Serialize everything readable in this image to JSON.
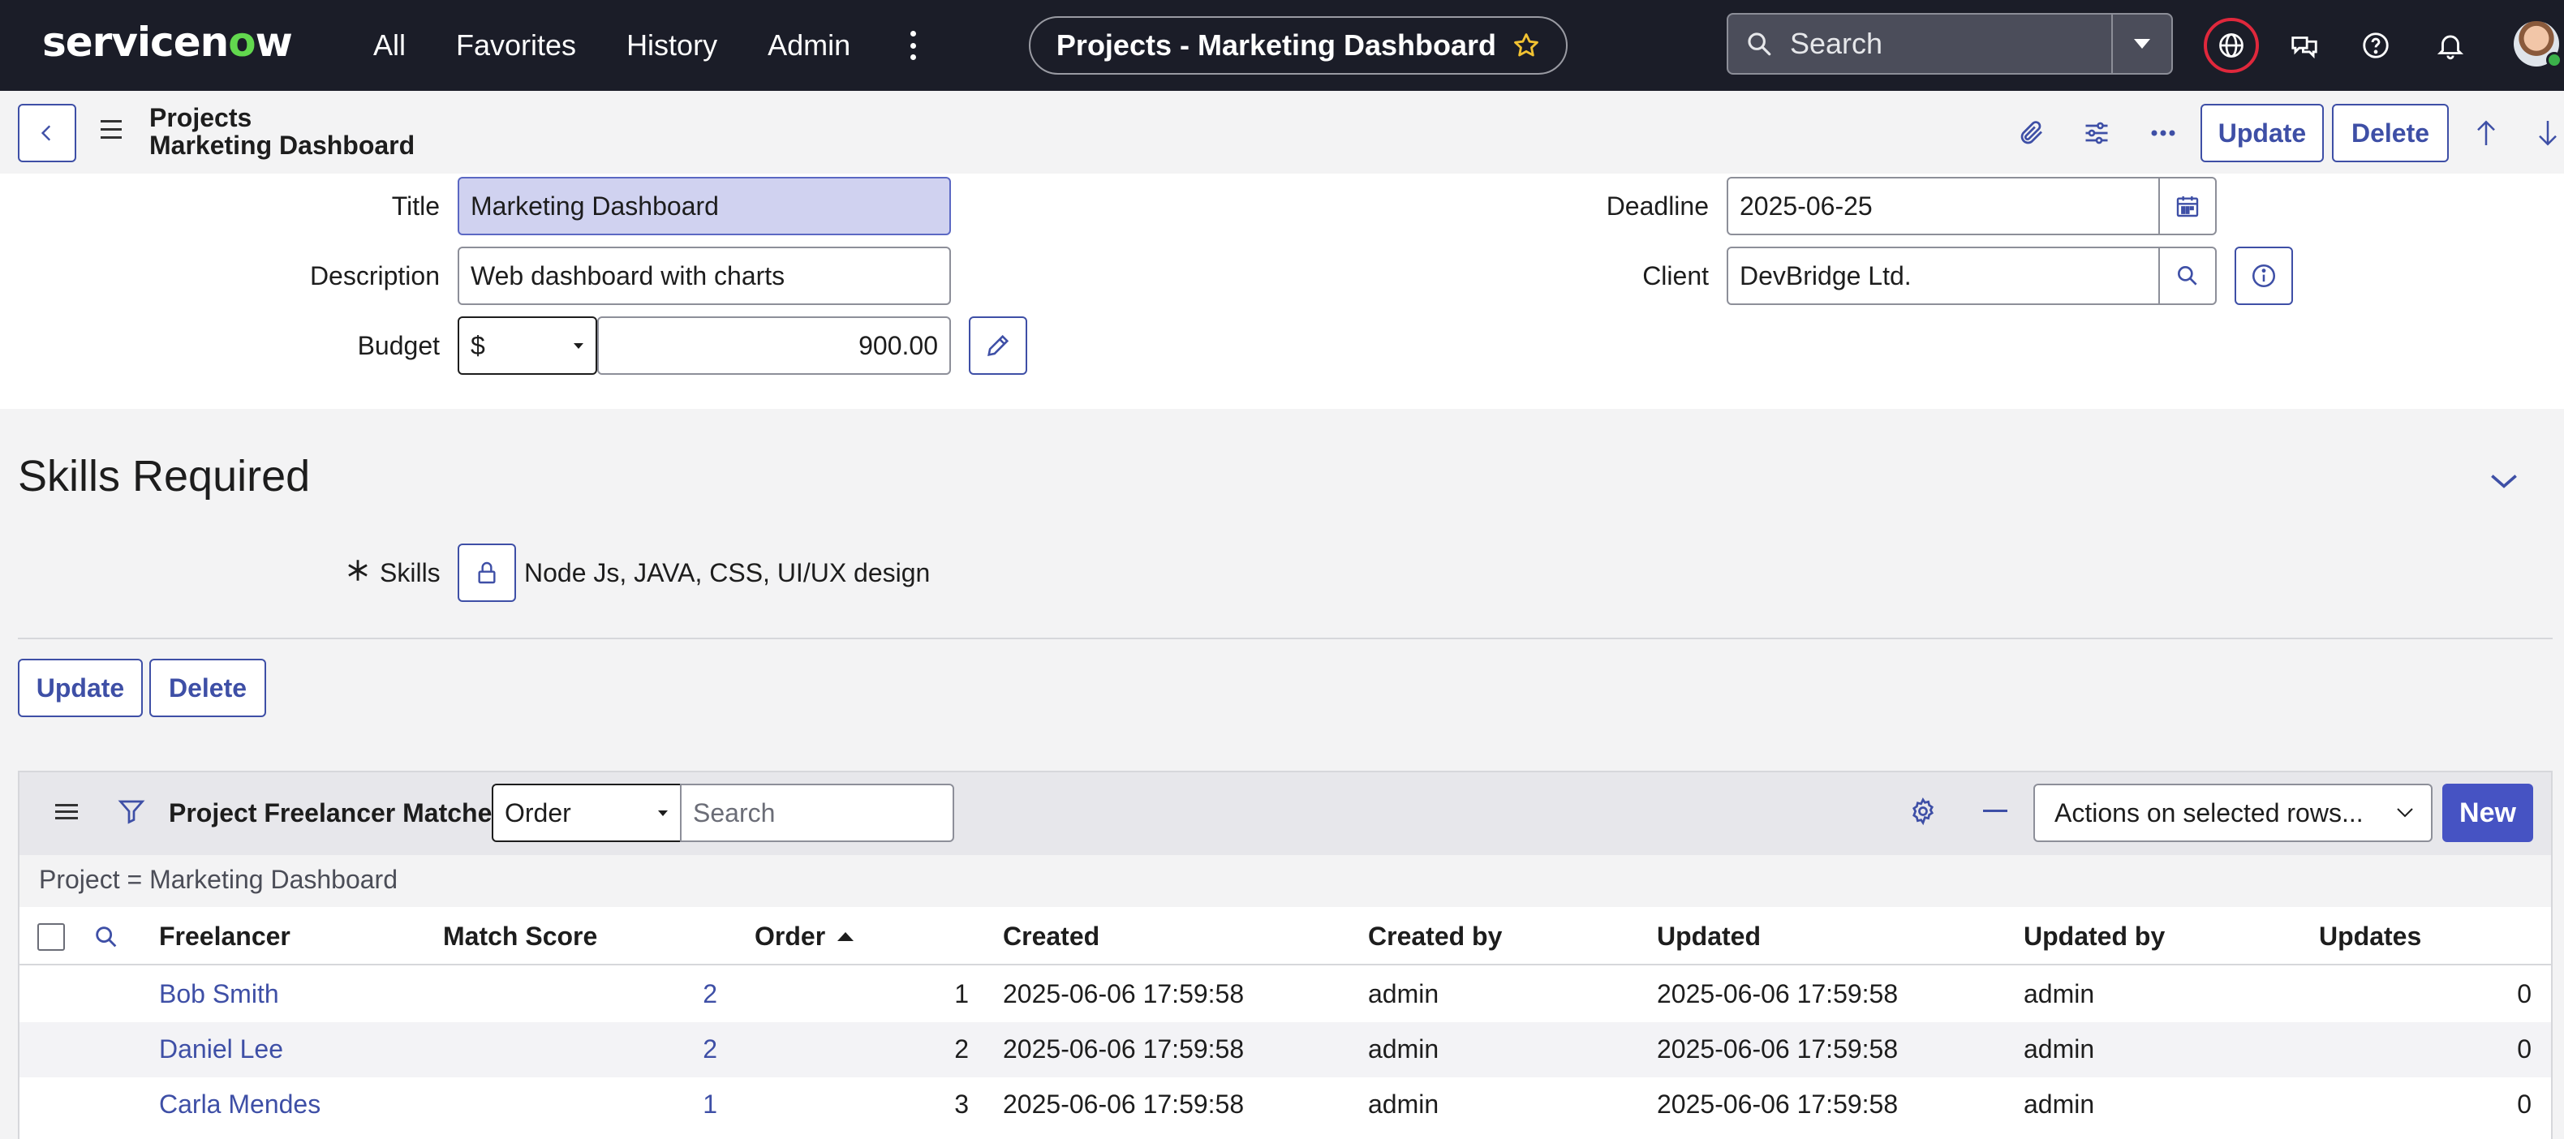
{
  "topnav": {
    "logo_prefix": "servicen",
    "logo_o": "o",
    "logo_suffix": "w",
    "links": [
      "All",
      "Favorites",
      "History",
      "Admin"
    ],
    "context_title": "Projects - Marketing Dashboard",
    "search_placeholder": "Search"
  },
  "header": {
    "breadcrumb_table": "Projects",
    "breadcrumb_record": "Marketing Dashboard",
    "update_label": "Update",
    "delete_label": "Delete"
  },
  "form": {
    "title_label": "Title",
    "title_value": "Marketing Dashboard",
    "description_label": "Description",
    "description_value": "Web dashboard with charts",
    "budget_label": "Budget",
    "budget_currency": "$",
    "budget_value": "900.00",
    "deadline_label": "Deadline",
    "deadline_value": "2025-06-25",
    "client_label": "Client",
    "client_value": "DevBridge Ltd."
  },
  "skills_section": {
    "title": "Skills Required",
    "skills_label": "Skills",
    "skills_value": "Node Js, JAVA, CSS, UI/UX design"
  },
  "bottom_actions": {
    "update_label": "Update",
    "delete_label": "Delete"
  },
  "related_list": {
    "title": "Project Freelancer Matches",
    "search_field": "Order",
    "search_placeholder": "Search",
    "actions_select": "Actions on selected rows...",
    "new_label": "New",
    "filter_text": "Project = Marketing Dashboard",
    "columns": [
      "Freelancer",
      "Match Score",
      "Order",
      "Created",
      "Created by",
      "Updated",
      "Updated by",
      "Updates"
    ],
    "rows": [
      {
        "freelancer": "Bob Smith",
        "match_score": "2",
        "order": "1",
        "created": "2025-06-06 17:59:58",
        "created_by": "admin",
        "updated": "2025-06-06 17:59:58",
        "updated_by": "admin",
        "updates": "0"
      },
      {
        "freelancer": "Daniel Lee",
        "match_score": "2",
        "order": "2",
        "created": "2025-06-06 17:59:58",
        "created_by": "admin",
        "updated": "2025-06-06 17:59:58",
        "updated_by": "admin",
        "updates": "0"
      },
      {
        "freelancer": "Carla Mendes",
        "match_score": "1",
        "order": "3",
        "created": "2025-06-06 17:59:58",
        "created_by": "admin",
        "updated": "2025-06-06 17:59:58",
        "updated_by": "admin",
        "updates": "0"
      }
    ]
  },
  "colors": {
    "nav_bg": "#1b1d28",
    "accent": "#3e4fa6",
    "logo_green": "#62d84e",
    "globe_ring": "#e0283c"
  },
  "icons": [
    "search-icon",
    "chevron-down-icon",
    "globe-icon",
    "chat-icon",
    "help-icon",
    "bell-icon",
    "star-icon",
    "back-arrow-icon",
    "hamburger-icon",
    "paperclip-icon",
    "sliders-icon",
    "more-icon",
    "arrow-up-icon",
    "arrow-down-icon",
    "calendar-icon",
    "info-icon",
    "pencil-icon",
    "lock-icon",
    "filter-icon",
    "gear-icon",
    "minus-icon",
    "checkbox-icon"
  ]
}
